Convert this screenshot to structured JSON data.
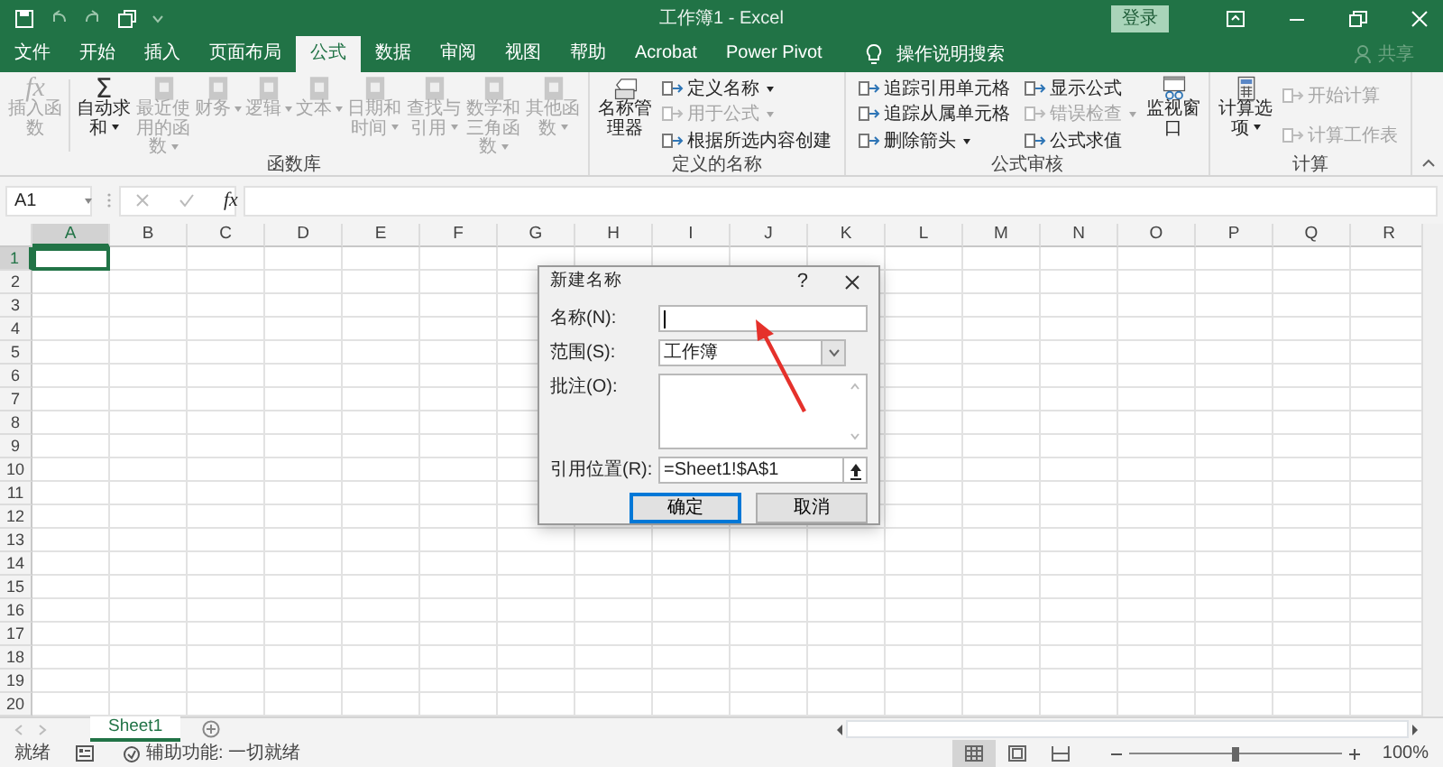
{
  "window": {
    "title": "工作簿1 - Excel",
    "login_button": "登录"
  },
  "tabs": [
    {
      "label": "文件",
      "selected": false
    },
    {
      "label": "开始",
      "selected": false
    },
    {
      "label": "插入",
      "selected": false
    },
    {
      "label": "页面布局",
      "selected": false
    },
    {
      "label": "公式",
      "selected": true
    },
    {
      "label": "数据",
      "selected": false
    },
    {
      "label": "审阅",
      "selected": false
    },
    {
      "label": "视图",
      "selected": false
    },
    {
      "label": "帮助",
      "selected": false
    },
    {
      "label": "Acrobat",
      "selected": false
    },
    {
      "label": "Power Pivot",
      "selected": false
    }
  ],
  "tell_me": "操作说明搜索",
  "share": {
    "label": "共享",
    "disabled": true
  },
  "ribbon": {
    "groups": [
      {
        "label": "函数库",
        "items": [
          {
            "kind": "large",
            "glyph": "fx",
            "label": "插入函数",
            "disabled": true,
            "dropdown": false
          },
          {
            "kind": "divider"
          },
          {
            "kind": "large",
            "glyph": "Σ",
            "label": "自动求和",
            "disabled": false,
            "dropdown": true
          },
          {
            "kind": "large",
            "label": "最近使用的函数",
            "disabled": true,
            "dropdown": true
          },
          {
            "kind": "large",
            "label": "财务",
            "disabled": true,
            "dropdown": true
          },
          {
            "kind": "large",
            "label": "逻辑",
            "disabled": true,
            "dropdown": true
          },
          {
            "kind": "large",
            "label": "文本",
            "disabled": true,
            "dropdown": true
          },
          {
            "kind": "large",
            "label": "日期和时间",
            "disabled": true,
            "dropdown": true
          },
          {
            "kind": "large",
            "label": "查找与引用",
            "disabled": true,
            "dropdown": true
          },
          {
            "kind": "large",
            "label": "数学和三角函数",
            "disabled": true,
            "dropdown": true
          },
          {
            "kind": "large",
            "label": "其他函数",
            "disabled": true,
            "dropdown": true
          }
        ]
      },
      {
        "label": "定义的名称",
        "items": [
          {
            "kind": "large",
            "label": "名称管理器",
            "disabled": false,
            "dropdown": false
          },
          {
            "kind": "stack",
            "items": [
              {
                "label": "定义名称",
                "disabled": false,
                "dropdown": true
              },
              {
                "label": "用于公式",
                "disabled": true,
                "dropdown": true
              },
              {
                "label": "根据所选内容创建",
                "disabled": false,
                "dropdown": false
              }
            ]
          }
        ]
      },
      {
        "label": "公式审核",
        "items": [
          {
            "kind": "stack",
            "items": [
              {
                "label": "追踪引用单元格",
                "disabled": false,
                "dropdown": false
              },
              {
                "label": "追踪从属单元格",
                "disabled": false,
                "dropdown": false
              },
              {
                "label": "删除箭头",
                "disabled": false,
                "dropdown": true
              }
            ]
          },
          {
            "kind": "stack",
            "items": [
              {
                "label": "显示公式",
                "disabled": false,
                "dropdown": false
              },
              {
                "label": "错误检查",
                "disabled": true,
                "dropdown": true
              },
              {
                "label": "公式求值",
                "disabled": false,
                "dropdown": false
              }
            ]
          },
          {
            "kind": "large",
            "label": "监视窗口",
            "disabled": false,
            "dropdown": false
          }
        ]
      },
      {
        "label": "计算",
        "items": [
          {
            "kind": "large",
            "label": "计算选项",
            "disabled": false,
            "dropdown": true
          },
          {
            "kind": "stack",
            "items": [
              {
                "label": "开始计算",
                "disabled": true,
                "dropdown": false
              },
              {
                "label": "计算工作表",
                "disabled": true,
                "dropdown": false
              }
            ]
          }
        ]
      }
    ]
  },
  "formula_bar": {
    "name_box": "A1",
    "function_glyph": "fx"
  },
  "sheet": {
    "columns": [
      {
        "label": "A",
        "selected": true
      },
      {
        "label": "B",
        "selected": false
      },
      {
        "label": "C",
        "selected": false
      },
      {
        "label": "D",
        "selected": false
      },
      {
        "label": "E",
        "selected": false
      },
      {
        "label": "F",
        "selected": false
      },
      {
        "label": "G",
        "selected": false
      },
      {
        "label": "H",
        "selected": false
      },
      {
        "label": "I",
        "selected": false
      },
      {
        "label": "J",
        "selected": false
      },
      {
        "label": "K",
        "selected": false
      },
      {
        "label": "L",
        "selected": false
      },
      {
        "label": "M",
        "selected": false
      },
      {
        "label": "N",
        "selected": false
      },
      {
        "label": "O",
        "selected": false
      },
      {
        "label": "P",
        "selected": false
      },
      {
        "label": "Q",
        "selected": false
      },
      {
        "label": "R",
        "selected": false
      }
    ],
    "rows": [
      {
        "label": "1",
        "selected": true
      },
      {
        "label": "2",
        "selected": false
      },
      {
        "label": "3",
        "selected": false
      },
      {
        "label": "4",
        "selected": false
      },
      {
        "label": "5",
        "selected": false
      },
      {
        "label": "6",
        "selected": false
      },
      {
        "label": "7",
        "selected": false
      },
      {
        "label": "8",
        "selected": false
      },
      {
        "label": "9",
        "selected": false
      },
      {
        "label": "10",
        "selected": false
      },
      {
        "label": "11",
        "selected": false
      },
      {
        "label": "12",
        "selected": false
      },
      {
        "label": "13",
        "selected": false
      },
      {
        "label": "14",
        "selected": false
      },
      {
        "label": "15",
        "selected": false
      },
      {
        "label": "16",
        "selected": false
      },
      {
        "label": "17",
        "selected": false
      },
      {
        "label": "18",
        "selected": false
      },
      {
        "label": "19",
        "selected": false
      },
      {
        "label": "20",
        "selected": false
      }
    ]
  },
  "sheet_tabs": [
    {
      "label": "Sheet1",
      "selected": true
    }
  ],
  "dialog": {
    "title": "新建名称",
    "help": "?",
    "fields": [
      {
        "kind": "text",
        "label": "名称(N):",
        "focused": true
      },
      {
        "kind": "select",
        "label": "范围(S):",
        "value": "工作簿"
      },
      {
        "kind": "textarea",
        "label": "批注(O):"
      },
      {
        "kind": "reference",
        "label": "引用位置(R):",
        "value": "=Sheet1!$A$1"
      }
    ],
    "buttons": [
      {
        "label": "确定",
        "default": true
      },
      {
        "label": "取消",
        "default": false
      }
    ]
  },
  "annotations": [
    {
      "kind": "arrow"
    }
  ],
  "status_bar": {
    "status": "就绪",
    "accessibility": "辅助功能: 一切就绪",
    "views": [
      {
        "kind": "normal",
        "selected": true
      },
      {
        "kind": "page_layout",
        "selected": false
      },
      {
        "kind": "page_break",
        "selected": false
      }
    ],
    "zoom": {
      "level": 0.5,
      "reading": "100%"
    }
  }
}
